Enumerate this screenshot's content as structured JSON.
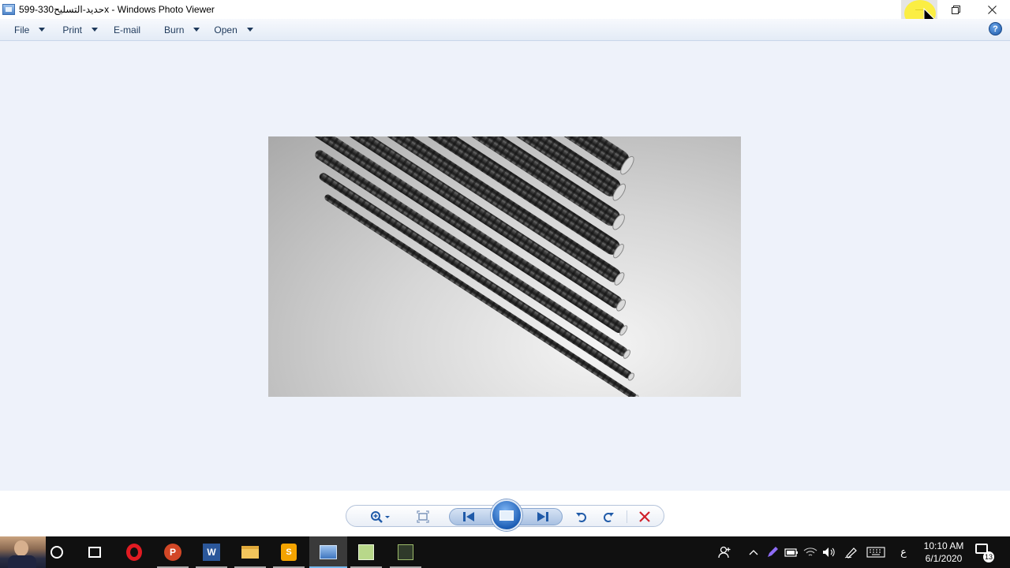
{
  "window": {
    "title": "599-حديد-التسليح330x - Windows Photo Viewer",
    "icon": "photo-viewer-icon",
    "controls": {
      "minimize": "minimize-icon",
      "restore": "restore-icon",
      "close": "close-icon"
    }
  },
  "menubar": {
    "items": [
      {
        "label": "File",
        "has_dropdown": true
      },
      {
        "label": "Print",
        "has_dropdown": true
      },
      {
        "label": "E-mail",
        "has_dropdown": false
      },
      {
        "label": "Burn",
        "has_dropdown": true
      },
      {
        "label": "Open",
        "has_dropdown": true
      }
    ],
    "help_label": "?"
  },
  "viewer": {
    "image_subject": "steel rebar rods"
  },
  "controls": {
    "zoom": "zoom-icon",
    "actual_size": "fit-window-icon",
    "previous": "previous-icon",
    "slideshow": "slideshow-icon",
    "next": "next-icon",
    "rotate_ccw": "rotate-left-icon",
    "rotate_cw": "rotate-right-icon",
    "delete": "delete-icon"
  },
  "taskbar": {
    "apps": [
      "cortana-icon",
      "task-view-icon",
      "opera-icon",
      "powerpoint-icon",
      "word-icon",
      "file-explorer-icon",
      "sumatra-pdf-icon",
      "photo-viewer-icon",
      "notepad-icon",
      "app-icon"
    ],
    "ppt_letter": "P",
    "word_letter": "W",
    "sumatra_letter": "S",
    "tray": {
      "language": "ع",
      "time": "10:10 AM",
      "date": "6/1/2020",
      "notifications": "13"
    }
  },
  "colors": {
    "menubar_text": "#1e395b",
    "viewer_bg": "#eef2fa",
    "delete_red": "#d0202a",
    "taskbar_bg": "#101010"
  }
}
